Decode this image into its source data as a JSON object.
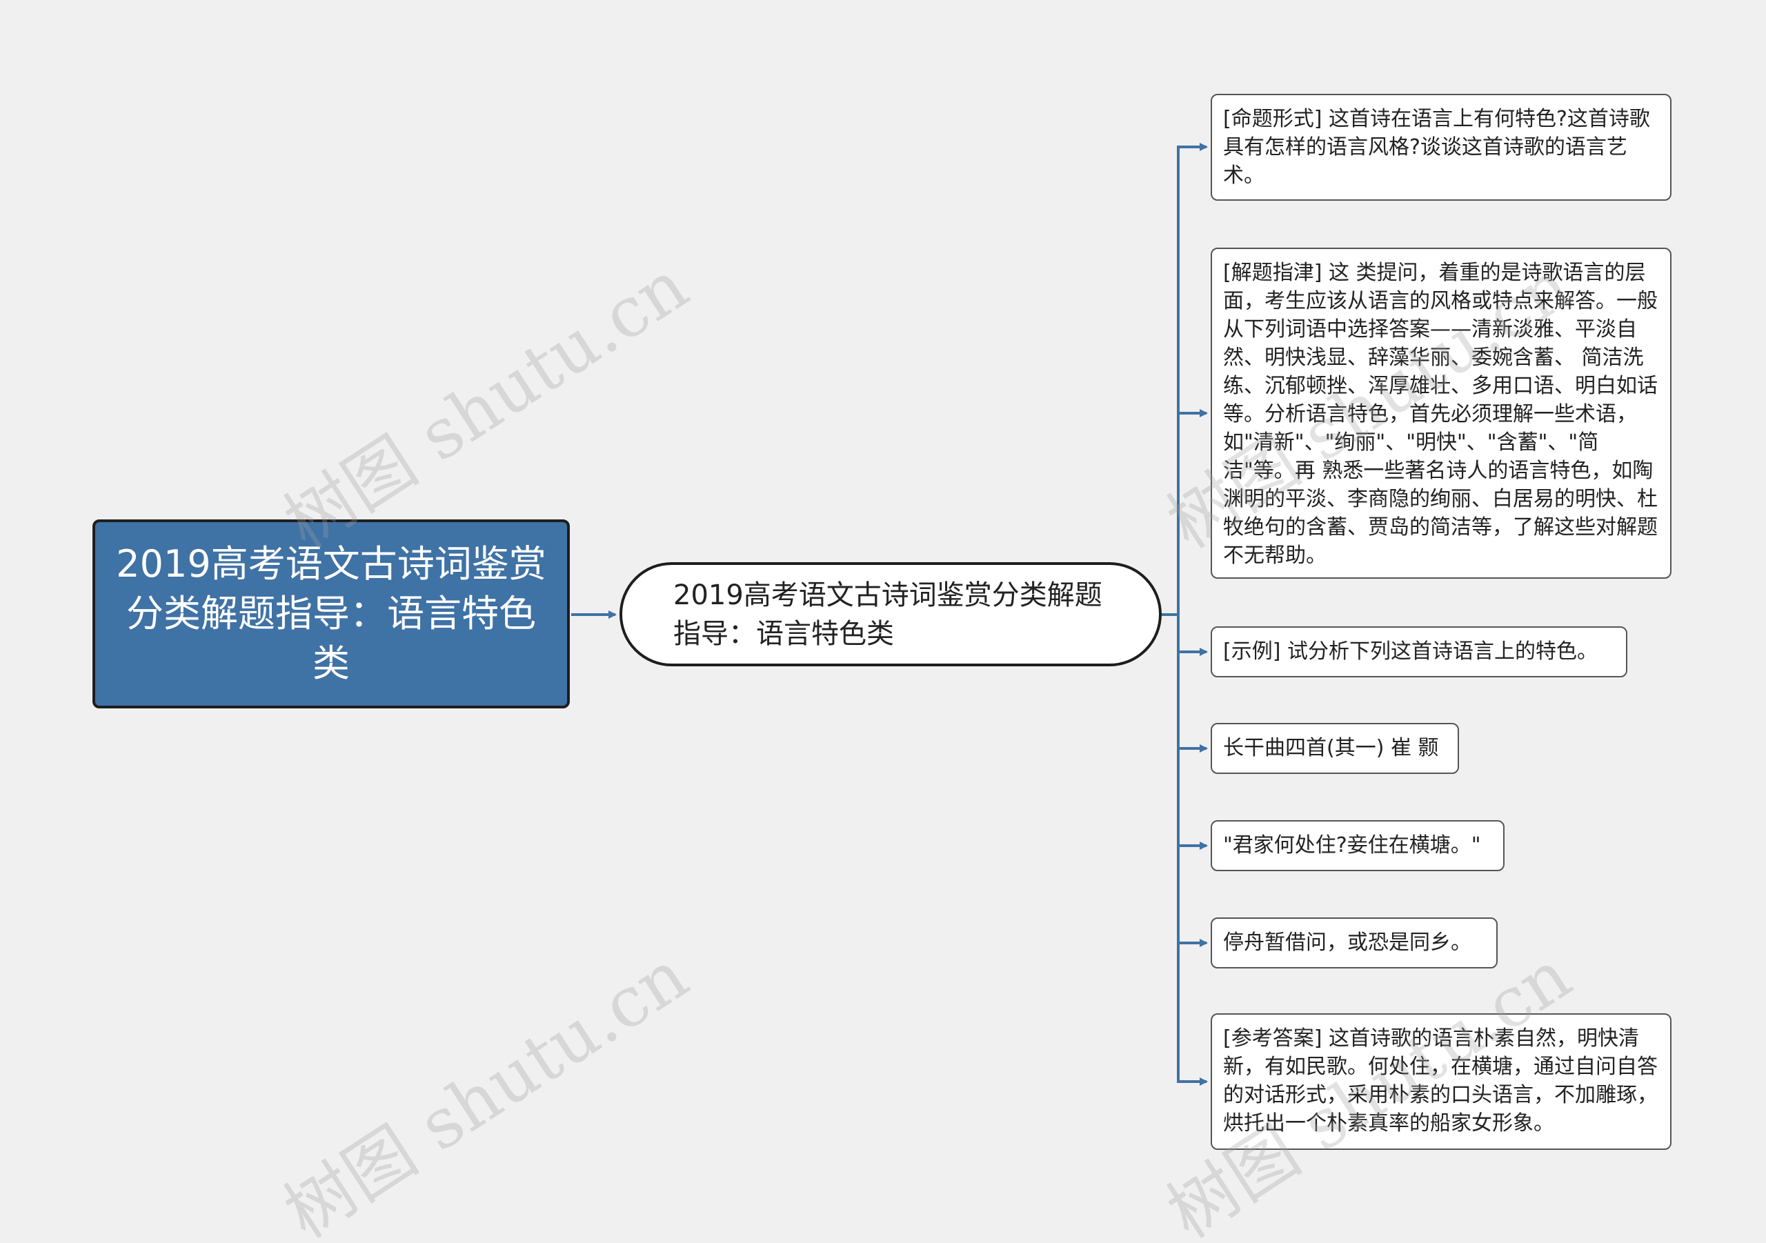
{
  "root": {
    "text": "2019高考语文古诗词鉴赏分类解题指导：语言特色类"
  },
  "topic": {
    "text": "2019高考语文古诗词鉴赏分类解题指导：语言特色类"
  },
  "leaves": [
    "[命题形式] 这首诗在语言上有何特色?这首诗歌具有怎样的语言风格?谈谈这首诗歌的语言艺术。",
    "[解题指津] 这 类提问，着重的是诗歌语言的层面，考生应该从语言的风格或特点来解答。一般从下列词语中选择答案——清新淡雅、平淡自然、明快浅显、辞藻华丽、委婉含蓄、 简洁洗练、沉郁顿挫、浑厚雄壮、多用口语、明白如话等。分析语言特色，首先必须理解一些术语，如\"清新\"、\"绚丽\"、\"明快\"、\"含蓄\"、\"简洁\"等。再 熟悉一些著名诗人的语言特色，如陶渊明的平淡、李商隐的绚丽、白居易的明快、杜牧绝句的含蓄、贾岛的简洁等，了解这些对解题不无帮助。",
    "[示例] 试分析下列这首诗语言上的特色。",
    "长干曲四首(其一) 崔 颢",
    "\"君家何处住?妾住在横塘。\"",
    "停舟暂借问，或恐是同乡。",
    "[参考答案] 这首诗歌的语言朴素自然，明快清新，有如民歌。何处住，在横塘，通过自问自答的对话形式，采用朴素的口头语言，不加雕琢，烘托出一个朴素真率的船家女形象。"
  ],
  "watermark": "树图 shutu.cn",
  "colors": {
    "background": "#f0f0f0",
    "root_fill": "#3f72a5",
    "connector": "#3f72a5"
  }
}
